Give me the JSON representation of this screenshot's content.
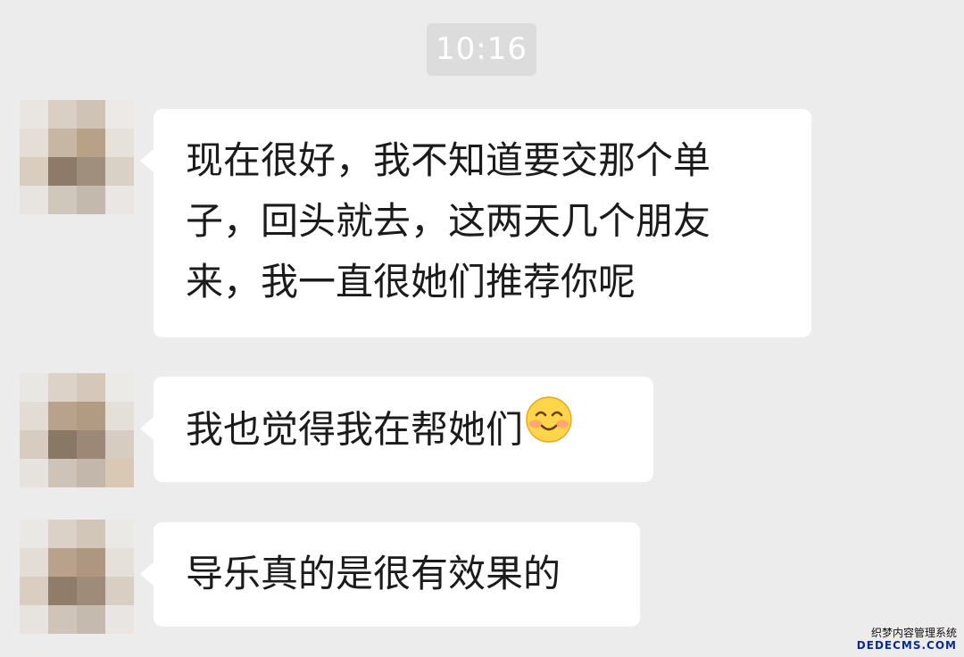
{
  "timestamp": "10:16",
  "messages": [
    {
      "lines": [
        "现在很好，我不知道要交那个单",
        "子，回头就去，这两天几个朋友",
        "来，我一直很她们推荐你呢"
      ]
    },
    {
      "text": "我也觉得我在帮她们",
      "emoji": "smiling-face-icon"
    },
    {
      "text": "导乐真的是很有效果的"
    }
  ],
  "watermark": {
    "line1": "织梦内容管理系统",
    "line2": "DEDECMS.COM"
  },
  "colors": {
    "background": "#ececec",
    "bubble": "#ffffff",
    "timestamp_bg": "#dcdcdc",
    "text": "#1b1b1b"
  }
}
